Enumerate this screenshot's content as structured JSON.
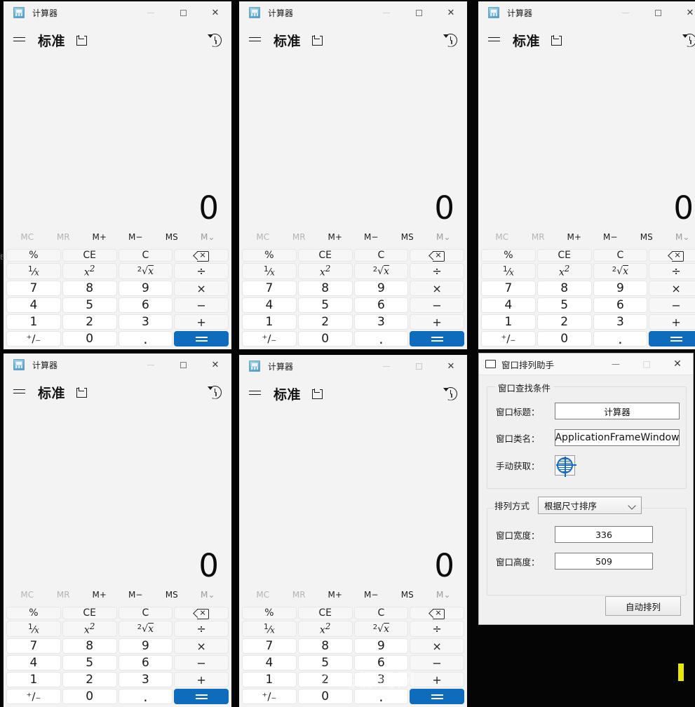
{
  "desktop": {
    "background_color": "#050505",
    "watermark": "YYDS源码网",
    "edge_letter": "E"
  },
  "calculator": {
    "title": "计算器",
    "icon": "calculator-icon",
    "window_controls": {
      "minimize": "—",
      "maximize": "□",
      "close": "✕"
    },
    "nav": {
      "menu_icon": "hamburger-icon",
      "mode": "标准",
      "keep_on_top_icon": "pin-window-icon",
      "history_icon": "history-icon"
    },
    "display_value": "0",
    "memory_buttons": [
      {
        "label": "MC",
        "state": "disabled"
      },
      {
        "label": "MR",
        "state": "disabled"
      },
      {
        "label": "M+",
        "state": "enabled"
      },
      {
        "label": "M−",
        "state": "enabled"
      },
      {
        "label": "MS",
        "state": "enabled"
      },
      {
        "label": "M⌄",
        "state": "half"
      }
    ],
    "keys": [
      {
        "label": "%",
        "type": "fn"
      },
      {
        "label": "CE",
        "type": "fn"
      },
      {
        "label": "C",
        "type": "fn"
      },
      {
        "label": "⌫",
        "type": "fn",
        "icon": "backspace-icon"
      },
      {
        "label": "¹⁄ₓ",
        "type": "fn"
      },
      {
        "label": "x²",
        "type": "fn"
      },
      {
        "label": "²√x",
        "type": "fn"
      },
      {
        "label": "÷",
        "type": "op"
      },
      {
        "label": "7",
        "type": "num"
      },
      {
        "label": "8",
        "type": "num"
      },
      {
        "label": "9",
        "type": "num"
      },
      {
        "label": "×",
        "type": "op"
      },
      {
        "label": "4",
        "type": "num"
      },
      {
        "label": "5",
        "type": "num"
      },
      {
        "label": "6",
        "type": "num"
      },
      {
        "label": "−",
        "type": "op"
      },
      {
        "label": "1",
        "type": "num"
      },
      {
        "label": "2",
        "type": "num"
      },
      {
        "label": "3",
        "type": "num"
      },
      {
        "label": "+",
        "type": "op"
      },
      {
        "label": "⁺∕₋",
        "type": "num"
      },
      {
        "label": "0",
        "type": "num"
      },
      {
        "label": ".",
        "type": "num"
      },
      {
        "label": "=",
        "type": "eq",
        "icon": "equals-icon",
        "accent": "#0f6cbd"
      }
    ]
  },
  "dialog": {
    "title": "窗口排列助手",
    "icon": "window-outline-icon",
    "window_controls": {
      "minimize": "—",
      "maximize": "□",
      "close": "✕"
    },
    "group_find": {
      "legend": "窗口查找条件",
      "fields": [
        {
          "label": "窗口标题：",
          "value": "计算器",
          "name": "window-title-input"
        },
        {
          "label": "窗口类名：",
          "value": "ApplicationFrameWindow",
          "name": "window-class-input"
        }
      ],
      "picker": {
        "label": "手动获取：",
        "icon": "target-crosshair-icon"
      }
    },
    "group_arrange": {
      "sort_label": "排列方式",
      "sort_value": "根据尺寸排序",
      "fields": [
        {
          "label": "窗口宽度：",
          "value": "336",
          "name": "window-width-input"
        },
        {
          "label": "窗口高度：",
          "value": "509",
          "name": "window-height-input"
        }
      ]
    },
    "action_button": "自动排列"
  }
}
